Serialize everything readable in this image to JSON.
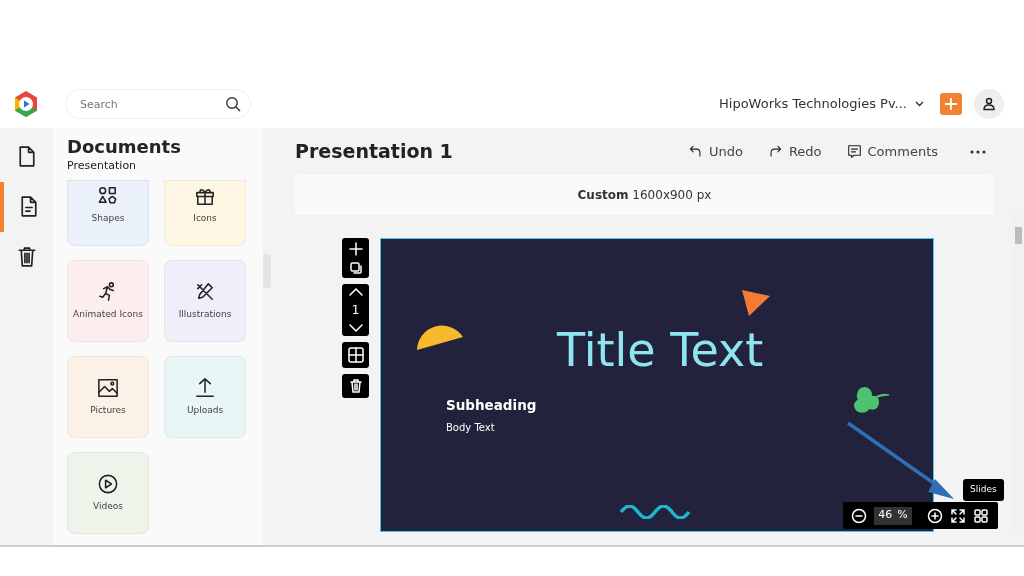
{
  "header": {
    "search": {
      "placeholder": "Search"
    },
    "organization": "HipoWorks Technologies Pv..."
  },
  "rail": [
    {
      "kind": "file",
      "selected": false
    },
    {
      "kind": "document",
      "selected": true
    },
    {
      "kind": "trash",
      "selected": false
    }
  ],
  "panel": {
    "title": "Documents",
    "subtitle": "Presentation",
    "tiles": [
      {
        "kind": "shapes",
        "label": "Shapes",
        "color": "#eaf1fa"
      },
      {
        "kind": "gift",
        "label": "Icons",
        "color": "#fdf6e3"
      },
      {
        "kind": "runner",
        "label": "Animated Icons",
        "color": "#fdeeee"
      },
      {
        "kind": "pencil",
        "label": "Illustrations",
        "color": "#efeff9"
      },
      {
        "kind": "image",
        "label": "Pictures",
        "color": "#fcf1e6"
      },
      {
        "kind": "upload",
        "label": "Uploads",
        "color": "#e8f6f6"
      },
      {
        "kind": "video",
        "label": "Videos",
        "color": "#edf5ea"
      }
    ]
  },
  "editor": {
    "title": "Presentation 1",
    "actions": [
      {
        "kind": "undo",
        "label": "Undo"
      },
      {
        "kind": "redo",
        "label": "Redo"
      },
      {
        "kind": "comments",
        "label": "Comments"
      }
    ],
    "canvas_size": "**Custom** 1600x900 px",
    "page_number": "1",
    "slide": {
      "title": "Title Text",
      "subheading": "Subheading",
      "body": "Body Text"
    },
    "zoom": {
      "value": "46",
      "unit": "%"
    },
    "tooltip": "Slides"
  }
}
